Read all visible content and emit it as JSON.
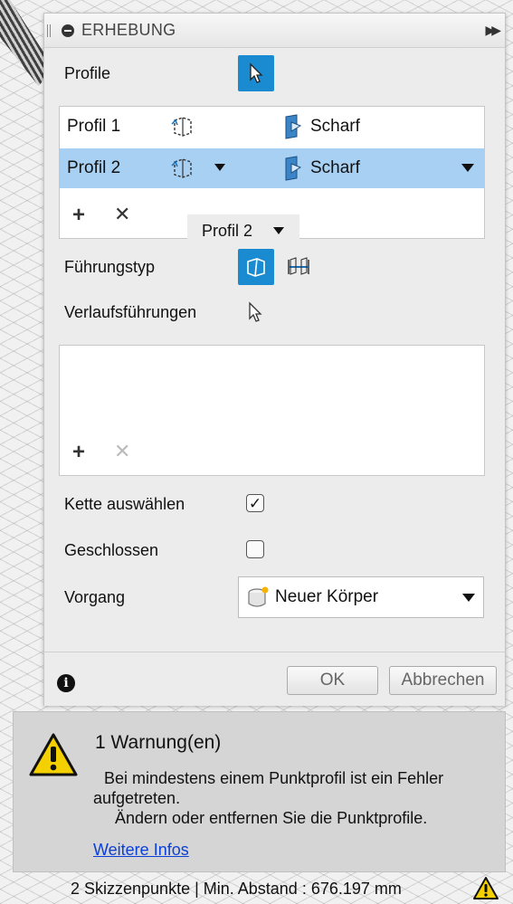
{
  "dialog": {
    "title": "ERHEBUNG",
    "profile_label": "Profile",
    "profiles": [
      {
        "name": "Profil 1",
        "condition": "Scharf",
        "selected": false
      },
      {
        "name": "Profil 2",
        "condition": "Scharf",
        "selected": true
      }
    ],
    "tooltip": "Profil 2",
    "guide_type_label": "Führungstyp",
    "rail_guides_label": "Verlaufsführungen",
    "chain_select_label": "Kette auswählen",
    "chain_select_checked": true,
    "closed_label": "Geschlossen",
    "closed_checked": false,
    "operation_label": "Vorgang",
    "operation_value": "Neuer Körper",
    "ok_label": "OK",
    "cancel_label": "Abbrechen"
  },
  "warning": {
    "title": "1 Warnung(en)",
    "line1": "Bei mindestens einem Punktprofil ist ein Fehler",
    "line2": "aufgetreten.",
    "line3": "Ändern oder entfernen Sie die Punktprofile.",
    "link": "Weitere Infos"
  },
  "status_bar": {
    "text": "2 Skizzenpunkte | Min. Abstand : 676.197 mm"
  },
  "colors": {
    "accent": "#1a8bd0",
    "selection": "#a8d0f3",
    "link": "#0b3fd6",
    "warning_yellow": "#f5d000"
  }
}
